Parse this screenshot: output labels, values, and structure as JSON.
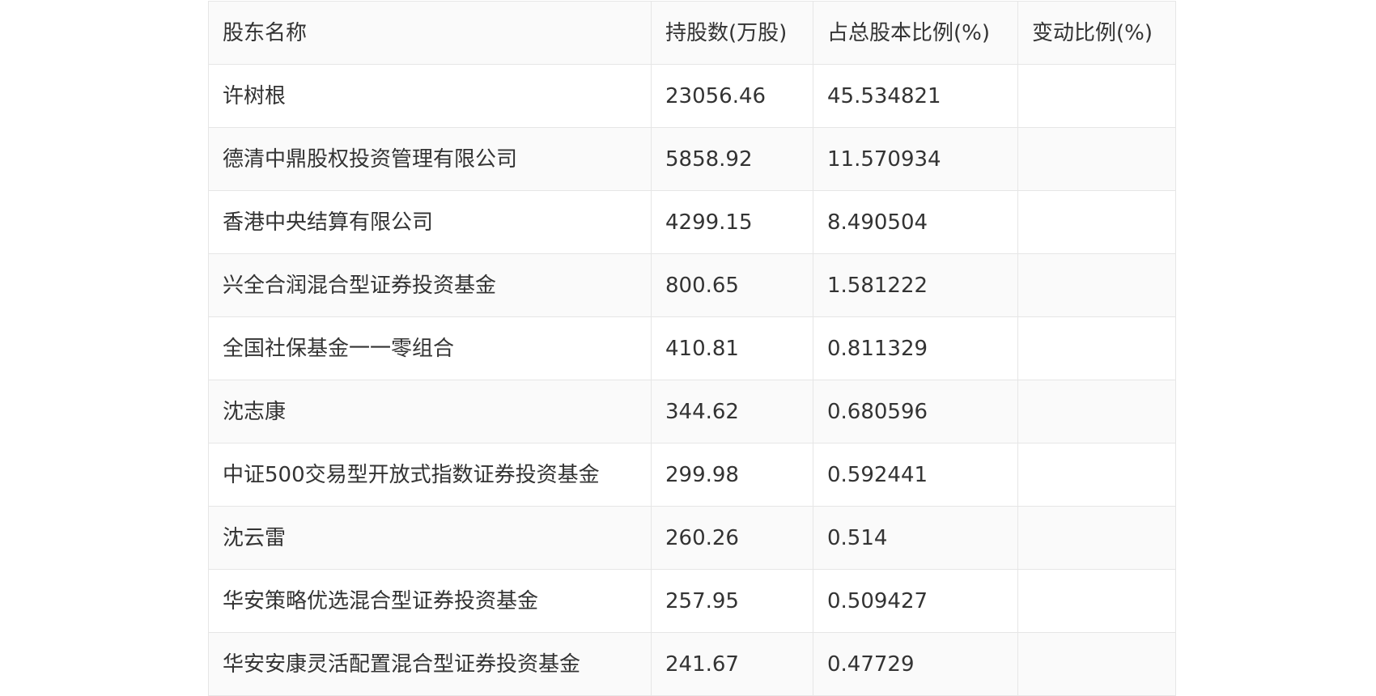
{
  "table": {
    "headers": [
      "股东名称",
      "持股数(万股)",
      "占总股本比例(%)",
      "变动比例(%)"
    ],
    "rows": [
      [
        "许树根",
        "23056.46",
        "45.534821",
        ""
      ],
      [
        "德清中鼎股权投资管理有限公司",
        "5858.92",
        "11.570934",
        ""
      ],
      [
        "香港中央结算有限公司",
        "4299.15",
        "8.490504",
        ""
      ],
      [
        "兴全合润混合型证券投资基金",
        "800.65",
        "1.581222",
        ""
      ],
      [
        "全国社保基金一一零组合",
        "410.81",
        "0.811329",
        ""
      ],
      [
        "沈志康",
        "344.62",
        "0.680596",
        ""
      ],
      [
        "中证500交易型开放式指数证券投资基金",
        "299.98",
        "0.592441",
        ""
      ],
      [
        "沈云雷",
        "260.26",
        "0.514",
        ""
      ],
      [
        "华安策略优选混合型证券投资基金",
        "257.95",
        "0.509427",
        ""
      ],
      [
        "华安安康灵活配置混合型证券投资基金",
        "241.67",
        "0.47729",
        ""
      ]
    ]
  }
}
